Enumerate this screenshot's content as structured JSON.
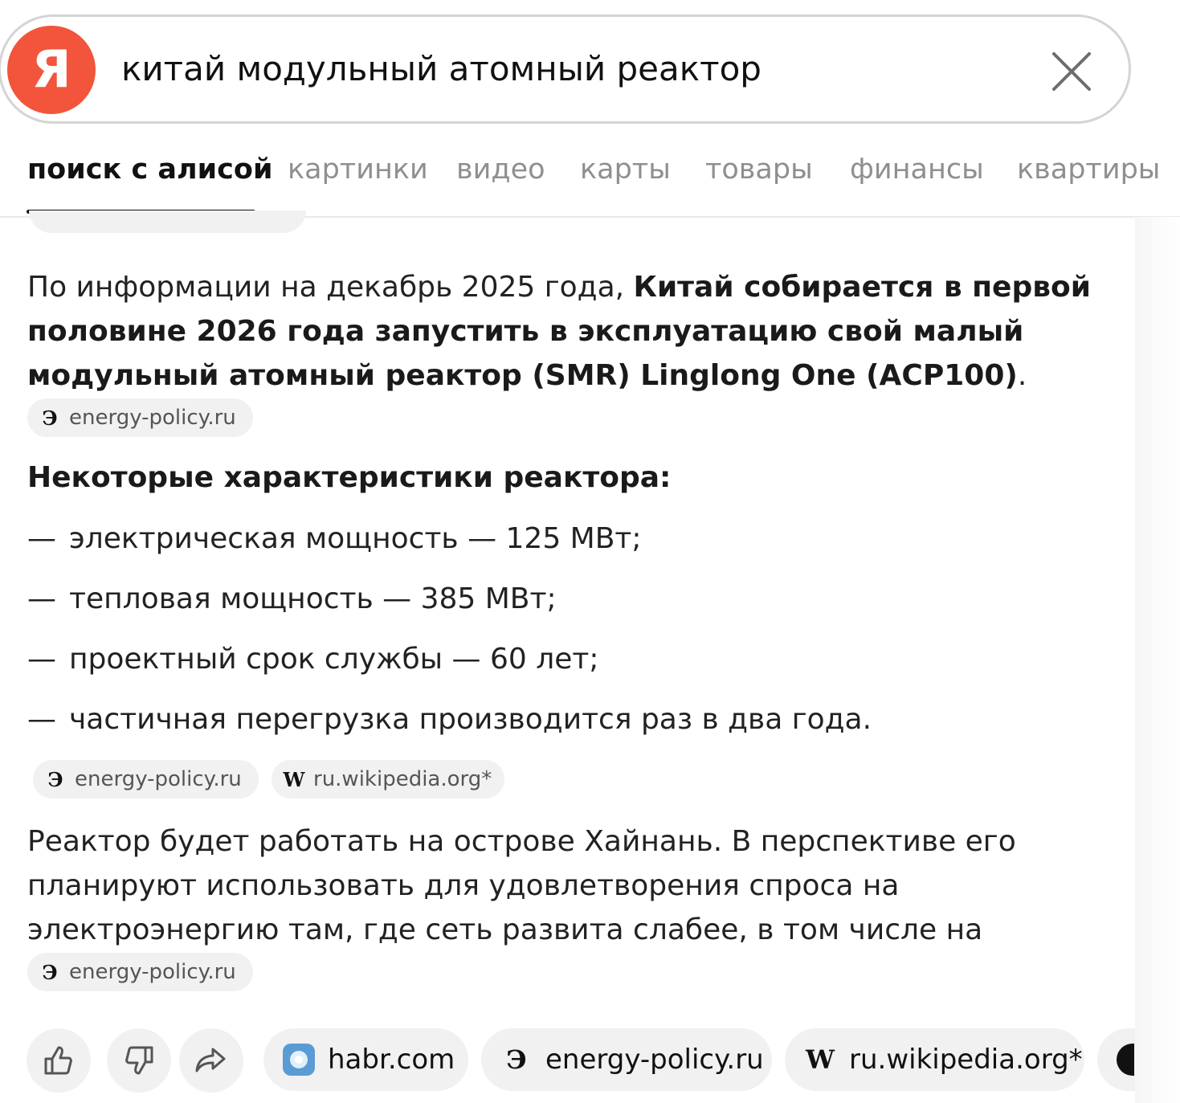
{
  "search": {
    "logo_letter": "Я",
    "query": "китай модульный атомный реактор"
  },
  "tabs": [
    {
      "label": "поиск с  алисой"
    },
    {
      "label": "картинки"
    },
    {
      "label": "видео"
    },
    {
      "label": "карты"
    },
    {
      "label": "товары"
    },
    {
      "label": "финансы"
    },
    {
      "label": "квартиры"
    }
  ],
  "answer": {
    "intro_plain": "По информации на декабрь 2025 года, ",
    "intro_bold": "Китай собирается в первой половине 2026 года запустить в эксплуатацию свой малый модульный атомный реактор (SMR) Linglong One (ACP100)",
    "intro_end": ".",
    "intro_source": {
      "icon": "Э",
      "label": "energy-policy.ru"
    },
    "heading": "Некоторые характеристики реактора:",
    "list": [
      "электрическая мощность — 125 МВт;",
      "тепловая мощность — 385 МВт;",
      "проектный срок службы — 60 лет;",
      "частичная перегрузка производится раз в два года."
    ],
    "list_dash": "—",
    "list_sources": [
      {
        "icon": "Э",
        "label": "energy-policy.ru"
      },
      {
        "icon": "W",
        "label": "ru.wikipedia.org*"
      }
    ],
    "outro": "Реактор будет работать на острове Хайнань. В перспективе его планируют использовать для удовлетворения спроса на электроэнергию там, где сеть развита слабее, в том числе на островах.",
    "outro_source": {
      "icon": "Э",
      "label": "energy-policy.ru"
    }
  },
  "bottom_sources": [
    {
      "icon": "habr-icon",
      "label": "habr.com"
    },
    {
      "icon": "Э",
      "label": "energy-policy.ru"
    },
    {
      "icon": "W",
      "label": "ru.wikipedia.org*"
    }
  ],
  "colors": {
    "brand": "#f2553b",
    "chip_bg": "#f1f1f1",
    "inactive_tab": "#8f8f8f"
  }
}
